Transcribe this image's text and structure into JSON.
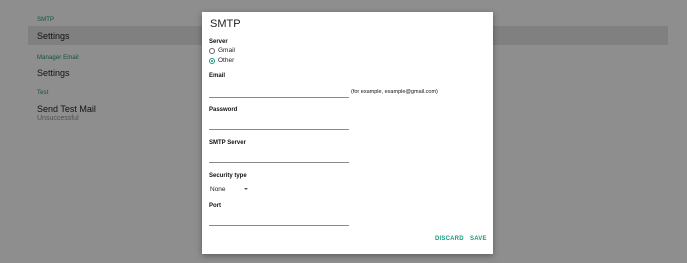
{
  "background": {
    "sections": [
      {
        "header": "SMTP",
        "items": [
          {
            "label": "Settings"
          }
        ]
      },
      {
        "header": "Manager Email",
        "items": [
          {
            "label": "Settings"
          }
        ]
      },
      {
        "header": "Test",
        "items": [
          {
            "label": "Send Test Mail",
            "sub": "Unsuccessful"
          }
        ]
      }
    ]
  },
  "dialog": {
    "title": "SMTP",
    "server": {
      "label": "Server",
      "options": [
        {
          "label": "Gmail",
          "checked": false
        },
        {
          "label": "Other",
          "checked": true
        }
      ]
    },
    "email": {
      "label": "Email",
      "value": "",
      "hint": "(for example, example@gmail.com)"
    },
    "password": {
      "label": "Password",
      "value": ""
    },
    "smtp_server": {
      "label": "SMTP Server",
      "value": ""
    },
    "security_type": {
      "label": "Security type",
      "selected": "None"
    },
    "port": {
      "label": "Port",
      "value": ""
    },
    "actions": {
      "discard": "DISCARD",
      "save": "SAVE"
    },
    "accent_color": "#1a9b80"
  }
}
